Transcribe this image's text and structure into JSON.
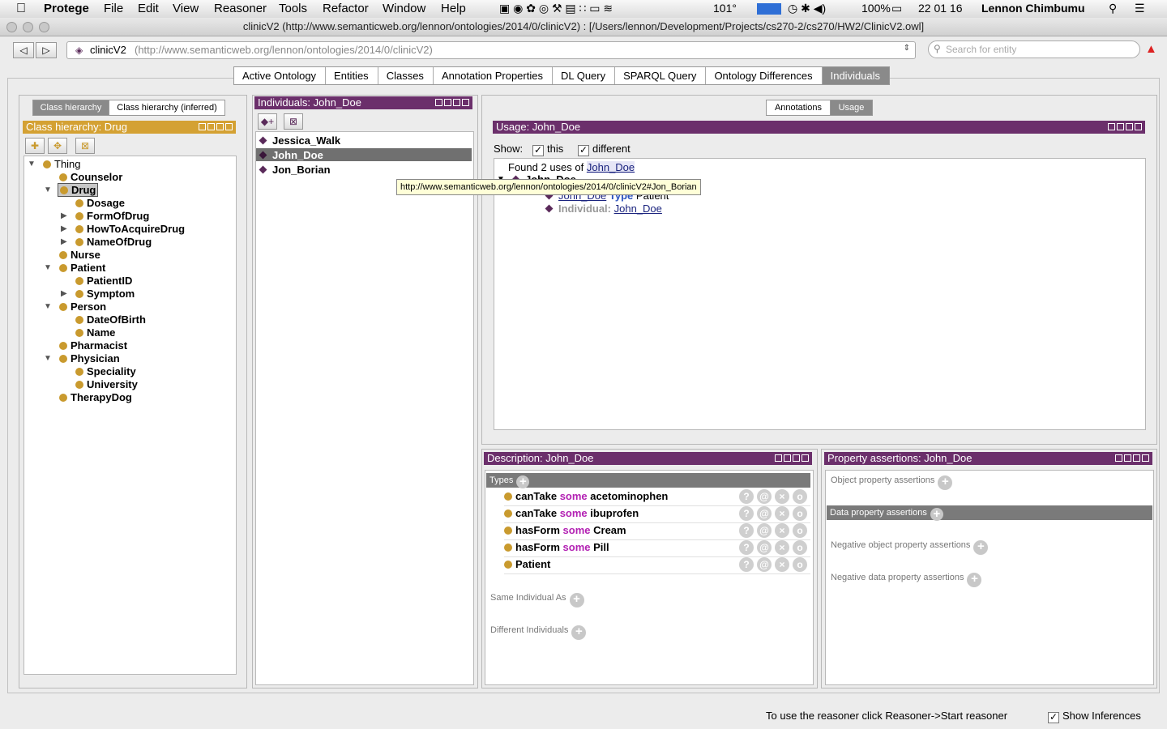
{
  "menubar": {
    "app": "Protege",
    "items": [
      "File",
      "Edit",
      "View",
      "Reasoner",
      "Tools",
      "Refactor",
      "Window",
      "Help"
    ],
    "temperature": "101°",
    "battery": "100%",
    "clock": "22 01 16",
    "user": "Lennon Chimbumu"
  },
  "window": {
    "title": "clinicV2 (http://www.semanticweb.org/lennon/ontologies/2014/0/clinicV2)  : [/Users/lennon/Development/Projects/cs270-2/cs270/HW2/ClinicV2.owl]"
  },
  "toolbar": {
    "back": "◁",
    "forward": "▷",
    "ontology_name": "clinicV2",
    "ontology_iri": "(http://www.semanticweb.org/lennon/ontologies/2014/0/clinicV2)",
    "search_placeholder": "Search for entity"
  },
  "tabs": [
    "Active Ontology",
    "Entities",
    "Classes",
    "Annotation Properties",
    "DL Query",
    "SPARQL Query",
    "Ontology Differences",
    "Individuals"
  ],
  "class_panel": {
    "tab_asserted": "Class hierarchy",
    "tab_inferred": "Class hierarchy (inferred)",
    "header": "Class hierarchy: Drug",
    "tree": [
      {
        "label": "Thing"
      },
      {
        "label": "Counselor"
      },
      {
        "label": "Drug"
      },
      {
        "label": "Dosage"
      },
      {
        "label": "FormOfDrug"
      },
      {
        "label": "HowToAcquireDrug"
      },
      {
        "label": "NameOfDrug"
      },
      {
        "label": "Nurse"
      },
      {
        "label": "Patient"
      },
      {
        "label": "PatientID"
      },
      {
        "label": "Symptom"
      },
      {
        "label": "Person"
      },
      {
        "label": "DateOfBirth"
      },
      {
        "label": "Name"
      },
      {
        "label": "Pharmacist"
      },
      {
        "label": "Physician"
      },
      {
        "label": "Speciality"
      },
      {
        "label": "University"
      },
      {
        "label": "TherapyDog"
      }
    ]
  },
  "individuals_panel": {
    "header": "Individuals: John_Doe",
    "items": [
      "Jessica_Walk",
      "John_Doe",
      "Jon_Borian"
    ]
  },
  "usage_panel": {
    "tab_annotations": "Annotations",
    "tab_usage": "Usage",
    "header": "Usage: John_Doe",
    "show_label": "Show:",
    "this_label": "this",
    "different_label": "different",
    "found_prefix": "Found 2 uses of",
    "found_entity": "John_Doe",
    "row_partial": "John_Doe",
    "row1_subject": "John_Doe",
    "row1_keyword": "Type",
    "row1_object": "Patient",
    "row2_label": "Individual:",
    "row2_value": "John_Doe"
  },
  "tooltip": "http://www.semanticweb.org/lennon/ontologies/2014/0/clinicV2#Jon_Borian",
  "description_panel": {
    "header": "Description: John_Doe",
    "types_label": "Types",
    "types": [
      {
        "prop": "canTake",
        "kw": "some",
        "filler": "acetominophen"
      },
      {
        "prop": "canTake",
        "kw": "some",
        "filler": "ibuprofen"
      },
      {
        "prop": "hasForm",
        "kw": "some",
        "filler": "Cream"
      },
      {
        "prop": "hasForm",
        "kw": "some",
        "filler": "Pill"
      },
      {
        "prop": "Patient",
        "kw": "",
        "filler": ""
      }
    ],
    "same_label": "Same Individual As",
    "different_label": "Different Individuals"
  },
  "property_panel": {
    "header": "Property assertions: John_Doe",
    "object_label": "Object property assertions",
    "data_label": "Data property assertions",
    "neg_object_label": "Negative object property assertions",
    "neg_data_label": "Negative data property assertions"
  },
  "status": {
    "message": "To use the reasoner click Reasoner->Start reasoner",
    "show_inferences": "Show Inferences"
  }
}
